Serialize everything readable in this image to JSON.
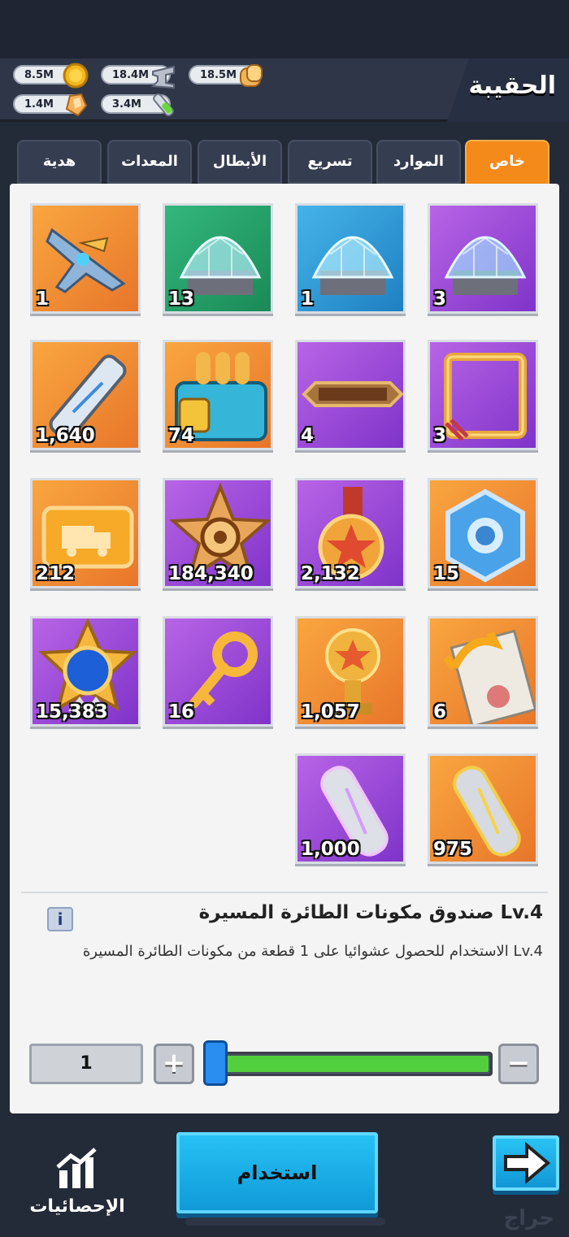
{
  "header": {
    "title": "الحقيبة",
    "resources": [
      {
        "value": "8.5M",
        "icon": "gold-coin-icon"
      },
      {
        "value": "18.4M",
        "icon": "iron-ingot-icon"
      },
      {
        "value": "18.5M",
        "icon": "bread-icon"
      },
      {
        "value": "1.4M",
        "icon": "crystal-icon"
      },
      {
        "value": "3.4M",
        "icon": "test-tube-icon"
      }
    ]
  },
  "tabs": [
    {
      "label": "خاص",
      "active": true
    },
    {
      "label": "الموارد"
    },
    {
      "label": "تسريع"
    },
    {
      "label": "الأبطال"
    },
    {
      "label": "المعدات"
    },
    {
      "label": "هدية"
    }
  ],
  "items": [
    {
      "count": "3",
      "icon": "shield-dome-icon",
      "color": "purple"
    },
    {
      "count": "1",
      "icon": "shield-dome-icon",
      "color": "blue"
    },
    {
      "count": "13",
      "icon": "shield-dome-icon",
      "color": "green"
    },
    {
      "count": "1",
      "icon": "drone-plane-icon",
      "color": "orange"
    },
    {
      "count": "3",
      "icon": "avatar-frame-icon",
      "color": "purple"
    },
    {
      "count": "4",
      "icon": "nameplate-icon",
      "color": "purple"
    },
    {
      "count": "74",
      "icon": "ammo-crate-icon",
      "color": "orange"
    },
    {
      "count": "1,640",
      "icon": "dna-tube-icon",
      "color": "orange"
    },
    {
      "count": "15",
      "icon": "hex-badge-icon",
      "color": "orange"
    },
    {
      "count": "2,132",
      "icon": "star-medal-icon",
      "color": "purple"
    },
    {
      "count": "184,340",
      "icon": "gold-star-emblem-icon",
      "color": "purple"
    },
    {
      "count": "212",
      "icon": "truck-ticket-icon",
      "color": "orange"
    },
    {
      "count": "6",
      "icon": "document-refresh-icon",
      "color": "orange"
    },
    {
      "count": "1,057",
      "icon": "trophy-icon",
      "color": "orange"
    },
    {
      "count": "16",
      "icon": "gold-key-icon",
      "color": "purple"
    },
    {
      "count": "15,383",
      "icon": "blue-star-badge-icon",
      "color": "orange"
    },
    {
      "count": "975",
      "icon": "gold-cylinder-icon",
      "color": "orange"
    },
    {
      "count": "1,000",
      "icon": "purple-cylinder-icon",
      "color": "purple"
    }
  ],
  "selected_item": {
    "name": "صندوق مكونات الطائرة المسيرة Lv.4",
    "description": "الاستخدام للحصول عشوائيا على 1 قطعة من مكونات الطائرة المسيرة Lv.4"
  },
  "quantity": {
    "value": "1",
    "plus_label": "+",
    "minus_label": "−",
    "slider_fraction": 1.0
  },
  "footer": {
    "stats_label": "الإحصائيات",
    "use_label": "استخدام",
    "watermark": "حراج"
  },
  "colors": {
    "accent": "#f48a1a",
    "use_button": "#1ba9e4",
    "slider_fill": "#52cf3c"
  }
}
